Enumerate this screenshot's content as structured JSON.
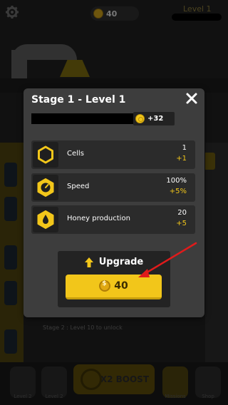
{
  "hud": {
    "coins": "40",
    "level_label": "Level 1"
  },
  "background": {
    "stage_note": "Stage 2 : Level 10 to unlock",
    "boost_label": "X2 BOOST",
    "nav": {
      "level1": "Level 2",
      "level2": "Level 2",
      "missions": "Missions",
      "shop": "Shop"
    }
  },
  "modal": {
    "title": "Stage 1 - Level 1",
    "reward": "+32",
    "stats": [
      {
        "name": "Cells",
        "value": "1",
        "delta": "+1",
        "icon": "hexagon-icon"
      },
      {
        "name": "Speed",
        "value": "100%",
        "delta": "+5%",
        "icon": "gauge-icon"
      },
      {
        "name": "Honey production",
        "value": "20",
        "delta": "+5",
        "icon": "honey-drop-icon"
      }
    ],
    "upgrade": {
      "label": "Upgrade",
      "price": "40"
    }
  },
  "colors": {
    "accent": "#f2c61a",
    "modal_bg": "#3d3d3d",
    "row_bg": "#2b2b2b",
    "annotation_arrow": "#e01b1b"
  }
}
